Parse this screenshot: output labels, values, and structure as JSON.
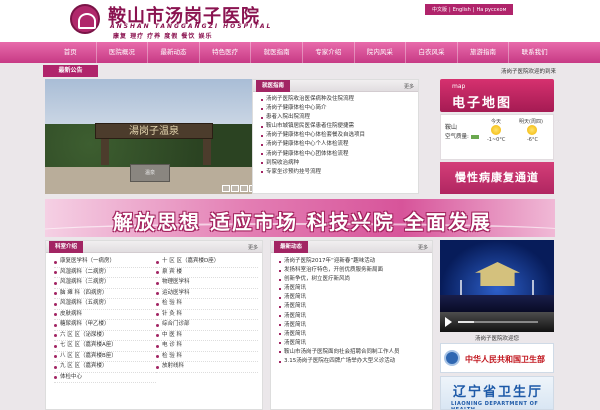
{
  "header": {
    "title": "鞍山市汤岗子医院",
    "subtitle": "ANSHAN TANGGANGZI HOSPITAL",
    "motto": "康复 理疗 疗养 度假 餐饮 娱乐",
    "languages": [
      "中文版",
      "English",
      "На русском"
    ]
  },
  "nav": {
    "items": [
      "首页",
      "医院概况",
      "最新动态",
      "特色医疗",
      "就医指南",
      "专家介绍",
      "院内风采",
      "白衣风采",
      "旅游指南",
      "联系我们"
    ]
  },
  "notice": {
    "title": "最新公告",
    "text": "汤岗子医院欢迎的到来"
  },
  "slideshow": {
    "sign_text": "湯岗子温泉",
    "stone_text": "温泉",
    "current": "6"
  },
  "guide_panel": {
    "title": "就医指南",
    "more": "更多",
    "items": [
      "汤岗子医院收治医保病种及住院流程",
      "汤岗子健康体检中心简介",
      "患者入院出院流程",
      "鞍山市城镇居民医保患者住院便捷需",
      "汤岗子健康体检中心体检套餐及自选项目",
      "汤岗子健康体检中心个人体检流程",
      "汤岗子健康体检中心团体体检流程",
      "到院收治病种",
      "专家坐诊预约挂号流程"
    ]
  },
  "map": {
    "small_label": "map",
    "label": "电子地图"
  },
  "weather": {
    "city": "鞍山",
    "air_label": "空气质量:",
    "today": "今天",
    "tomorrow": "明天(周四)",
    "today_temp": "-1~0°C",
    "tomorrow_temp": "-6°C"
  },
  "rehab": {
    "label": "慢性病康复通道"
  },
  "banner": {
    "text": "解放思想 适应市场 科技兴院 全面发展"
  },
  "dept_panel": {
    "title": "科室介绍",
    "more": "更多",
    "col1": [
      "康复医学科（一病房）",
      "风湿病科（二病房）",
      "风湿病科（三病房）",
      "脑 瘫 科（四病房）",
      "风湿病科（五病房）",
      "皮肤病科",
      "糖尿病科（甲乙楼）",
      "六 区 区（泌尿楼）",
      "七 区 区（嘉宾楼A座）",
      "八 区 区（嘉宾楼B座）",
      "九 区 区（嘉宾楼）",
      "体检中心"
    ],
    "col2": [
      "十 区 区（嘉宾楼D座）",
      "泉 宾 楼",
      "物理医学科",
      "运动医学科",
      "检 验 科",
      "针 灸 科",
      "综合门诊部",
      "中 医 科",
      "电 诊 科",
      "检 验 科",
      "放射线科"
    ]
  },
  "news_panel": {
    "title": "最新动态",
    "more": "更多",
    "items": [
      "汤岗子医院2017年“迎新春”趣味活动",
      "发扬科室治疗特色，开创优质服务新局面",
      "创新争优，树立医疗新风尚",
      "汤医简讯",
      "汤医简讯",
      "汤医简讯",
      "汤医简讯",
      "汤医简讯",
      "汤医简讯",
      "汤医简讯",
      "鞍山市汤岗子医院面向社会招聘合同制工作人员",
      "3.15汤岗子医院在四牌广场举办大型义诊活动"
    ]
  },
  "video": {
    "caption": "汤岗子医院欢迎您"
  },
  "links": {
    "moh": "中华人民共和国卫生部",
    "ln": "辽宁省卫生厅",
    "ln_en": "LIAONING DEPARTMENT OF HEALTH"
  },
  "colors": {
    "brand": "#a22563",
    "nav": "#d9509a"
  }
}
